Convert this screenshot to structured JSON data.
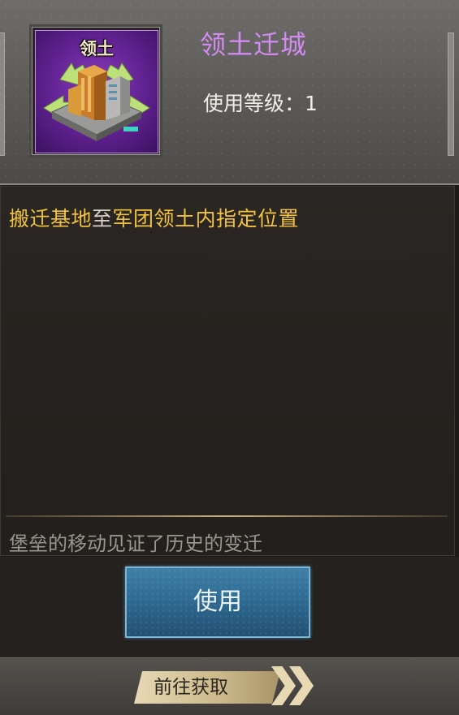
{
  "item": {
    "icon_caption": "领土",
    "title": "领土迁城",
    "level_label": "使用等级：1"
  },
  "description": {
    "segments": [
      {
        "text": "搬迁基地",
        "color": "#f2c23e"
      },
      {
        "text": "至",
        "color": "#d6d1c6"
      },
      {
        "text": "军团领土内指定位置",
        "color": "#f2c23e"
      }
    ],
    "flavor": "堡垒的移动见证了历史的变迁"
  },
  "actions": {
    "use_label": "使用",
    "goto_label": "前往获取"
  },
  "icons": {
    "item_icon": "territory-relocation-building-icon",
    "goto_icon": "double-chevron-right-icon"
  },
  "colors": {
    "title": "#d28bf2",
    "highlight": "#f2c23e",
    "use_button": "#2e6990",
    "goto_button": "#e6d9b3"
  }
}
